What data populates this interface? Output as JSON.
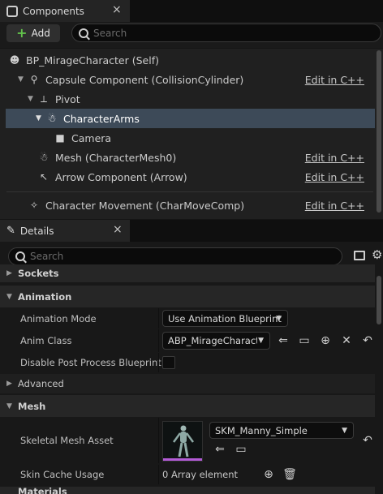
{
  "components_panel": {
    "tab_label": "Components",
    "close_glyph": "×",
    "add_label": "Add",
    "search_placeholder": "Search",
    "rows": [
      {
        "label": "BP_MirageCharacter (Self)",
        "icon": "character-icon",
        "edit": ""
      },
      {
        "label": "Capsule Component (CollisionCylinder)",
        "icon": "capsule-icon",
        "edit": "Edit in C++"
      },
      {
        "label": "Pivot",
        "icon": "scene-icon",
        "edit": ""
      },
      {
        "label": "CharacterArms",
        "icon": "skeletal-mesh-icon",
        "edit": "",
        "selected": true
      },
      {
        "label": "Camera",
        "icon": "camera-icon",
        "edit": ""
      },
      {
        "label": "Mesh (CharacterMesh0)",
        "icon": "skeletal-mesh-icon",
        "edit": "Edit in C++"
      },
      {
        "label": "Arrow Component (Arrow)",
        "icon": "arrow-component-icon",
        "edit": "Edit in C++"
      },
      {
        "label": "Character Movement (CharMoveComp)",
        "icon": "movement-icon",
        "edit": "Edit in C++"
      }
    ]
  },
  "details_panel": {
    "tab_label": "Details",
    "close_glyph": "×",
    "search_placeholder": "Search",
    "sections": {
      "sockets": "Sockets",
      "animation": "Animation",
      "advanced": "Advanced",
      "mesh": "Mesh",
      "partial_next": "Materials"
    },
    "properties": {
      "animation_mode": {
        "name": "Animation Mode",
        "value": "Use Animation Blueprint"
      },
      "anim_class": {
        "name": "Anim Class",
        "value": "ABP_MirageCharact"
      },
      "disable_post_process": {
        "name": "Disable Post Process Blueprint",
        "checked": false
      },
      "skeletal_mesh_asset": {
        "name": "Skeletal Mesh Asset",
        "value": "SKM_Manny_Simple"
      },
      "skin_cache_usage": {
        "name": "Skin Cache Usage",
        "value": "0 Array element"
      }
    }
  },
  "colors": {
    "selection": "#3d4a58",
    "add_plus": "#62c24b",
    "thumbnail_accent": "#b35bd6"
  }
}
